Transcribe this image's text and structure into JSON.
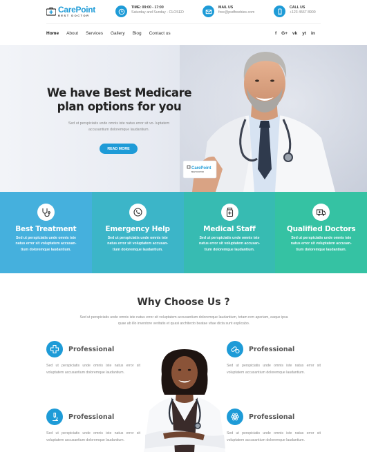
{
  "header": {
    "logo": {
      "name_part1": "Care",
      "name_part2": "Point",
      "tagline": "BEST DOCTOR"
    },
    "info": [
      {
        "icon": "clock-icon",
        "title": "TIME: 09:00 - 17:00",
        "value": "Saturday and Sunday - CLOSED"
      },
      {
        "icon": "mail-icon",
        "title": "MAIL US",
        "value": "free@psdfreebies.com"
      },
      {
        "icon": "phone-icon",
        "title": "CALL US",
        "value": "+123 4567 8900"
      }
    ]
  },
  "nav": {
    "items": [
      "Home",
      "About",
      "Services",
      "Gallery",
      "Blog",
      "Contact us"
    ],
    "social": [
      "f",
      "G+",
      "vk",
      "yt",
      "in"
    ]
  },
  "hero": {
    "title": "We have Best Medicare plan options for you",
    "text": "Sed ut perspiciatis unde omnis iste natus error sit vo- luptatem accusantium doloremque laudantium.",
    "button": "READ MORE",
    "card_logo": "CarePoint",
    "card_tagline": "BEST DOCTOR"
  },
  "features": [
    {
      "icon": "stethoscope-icon",
      "title": "Best Treatment",
      "text": "Sed ut perspiciatis unde omnis iste natus error sit voluptatem accusan- tium doloremque laudantium.",
      "color": "#45b0dd"
    },
    {
      "icon": "phone-call-icon",
      "title": "Emergency Help",
      "text": "Sed ut perspiciatis unde omnis iste natus error sit voluptatem accusan- tium doloremque laudantium.",
      "color": "#3cb5c8"
    },
    {
      "icon": "medicine-bottle-icon",
      "title": "Medical Staff",
      "text": "Sed ut perspiciatis unde omnis iste natus error sit voluptatem accusan- tium doloremque laudantium.",
      "color": "#37bbb2"
    },
    {
      "icon": "ambulance-icon",
      "title": "Qualified Doctors",
      "text": "Sed ut perspiciatis unde omnis iste natus error sit voluptatem accusan- tium doloremque laudantium.",
      "color": "#35c2a3"
    }
  ],
  "why": {
    "title": "Why Choose Us ?",
    "text": "Sed ut perspiciatis unde omnis iste natus error sit voluptatem accusantium doloremque laudantium, totam rem aperiam, eaque ipsa quae ab illo inventore veritatis et quasi architecto beatae vitae dicta sunt explicabo.",
    "items": [
      {
        "icon": "medical-cross-icon",
        "title": "Professional",
        "text": "Sed ut perspiciatis unde omnis iste natus error sit voluptatem accusantium doloremque laudantium."
      },
      {
        "icon": "pills-icon",
        "title": "Professional",
        "text": "Sed ut perspiciatis unde omnis iste natus error sit voluptatem accusantium doloremque laudantium."
      },
      {
        "icon": "microscope-icon",
        "title": "Professional",
        "text": "Sed ut perspiciatis unde omnis iste natus error sit voluptatem accusantium doloremque laudantium."
      },
      {
        "icon": "atom-icon",
        "title": "Professional",
        "text": "Sed ut perspiciatis unde omnis iste natus error sit voluptatem accusantium doloremque laudantium."
      }
    ]
  },
  "colors": {
    "primary": "#1e9bd7"
  }
}
